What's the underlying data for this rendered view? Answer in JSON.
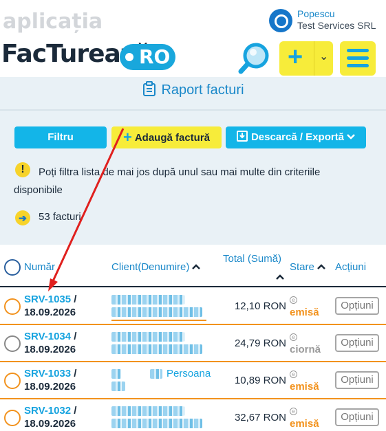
{
  "brand": {
    "top_text": "aplicația",
    "main_text": "FacTurează",
    "badge_text": "RO"
  },
  "user": {
    "name": "Popescu",
    "company": "Test Services SRL"
  },
  "toolbar": {
    "plus_label": "+",
    "chevron": "⌄"
  },
  "page": {
    "title": "Raport facturi"
  },
  "actions": {
    "filter_label": "Filtru",
    "add_label": "Adaugă factură",
    "add_plus": "+",
    "export_label": "Descarcă / Exportă"
  },
  "info": {
    "icon_text": "!",
    "text": "Poți filtra lista de mai jos după unul sau mai multe din criteriile disponibile"
  },
  "count": {
    "icon_text": "➔",
    "text": "53 facturi"
  },
  "table": {
    "headers": {
      "number": "Număr",
      "client": "Client(Denumire)",
      "total": "Total (Sumă)",
      "status": "Stare",
      "actions": "Acțiuni"
    },
    "rows": [
      {
        "number": "SRV-1035",
        "date": "18.09.2026",
        "client_visible": "",
        "total": "12,10 RON",
        "status": "emisă",
        "status_color": "#f2921d",
        "option": "Opțiuni",
        "check_color": "#f2921d",
        "line_color": "#f2921d"
      },
      {
        "number": "SRV-1034",
        "date": "18.09.2026",
        "client_visible": "",
        "total": "24,79 RON",
        "status": "ciornă",
        "status_color": "#9a9a9a",
        "option": "Opțiuni",
        "check_color": "#888888",
        "line_color": "#f2921d"
      },
      {
        "number": "SRV-1033",
        "date": "18.09.2026",
        "client_visible": "Persoana",
        "total": "10,89 RON",
        "status": "emisă",
        "status_color": "#f2921d",
        "option": "Opțiuni",
        "check_color": "#f2921d",
        "line_color": "#f2921d"
      },
      {
        "number": "SRV-1032",
        "date": "18.09.2026",
        "client_visible": "",
        "total": "32,67 RON",
        "status": "emisă",
        "status_color": "#f2921d",
        "option": "Opțiuni",
        "check_color": "#f2921d",
        "line_color": "#f2921d"
      }
    ],
    "status_icon": "e",
    "separator": "/"
  },
  "colors": {
    "accent": "#16a3df",
    "yellow": "#f7ec3a",
    "orange": "#f2921d",
    "band": "#e9f1f6",
    "annotation_arrow": "#e0201e"
  }
}
